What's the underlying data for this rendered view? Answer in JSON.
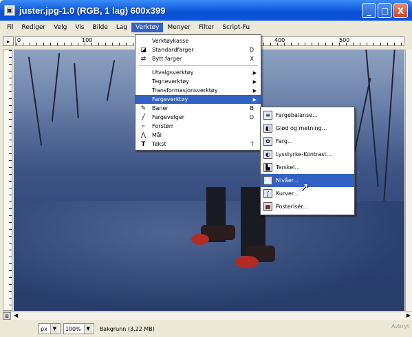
{
  "window": {
    "title": "juster.jpg-1.0 (RGB, 1 lag) 600x399",
    "controls": [
      "_",
      "□",
      "X"
    ]
  },
  "menubar": {
    "items": [
      "Fil",
      "Rediger",
      "Velg",
      "Vis",
      "Bilde",
      "Lag",
      "Verktøy",
      "Menyer",
      "Filter",
      "Script-Fu"
    ],
    "active": "Verktøy"
  },
  "ruler": {
    "labels": [
      "0",
      "100",
      "400",
      "500"
    ]
  },
  "tools_menu": {
    "items": [
      {
        "label": "Verktøykasse",
        "icon": "",
        "shortcut": "",
        "submenu": false
      },
      {
        "label": "Standardfarger",
        "icon": "default-colors-icon",
        "shortcut": "D",
        "submenu": false
      },
      {
        "label": "Bytt farger",
        "icon": "swap-colors-icon",
        "shortcut": "X",
        "submenu": false
      },
      {
        "separator": true
      },
      {
        "label": "Utvalgsverktøy",
        "icon": "",
        "shortcut": "",
        "submenu": true
      },
      {
        "label": "Tegneverktøy",
        "icon": "",
        "shortcut": "",
        "submenu": true
      },
      {
        "label": "Transformasjonsverktøy",
        "icon": "",
        "shortcut": "",
        "submenu": true
      },
      {
        "label": "Fargeverktøy",
        "icon": "",
        "shortcut": "",
        "submenu": true,
        "highlighted": true
      },
      {
        "label": "Baner",
        "icon": "paths-icon",
        "shortcut": "B",
        "submenu": false
      },
      {
        "label": "Fargevelger",
        "icon": "color-picker-icon",
        "shortcut": "O",
        "submenu": false
      },
      {
        "label": "Forstørr",
        "icon": "zoom-icon",
        "shortcut": "",
        "submenu": false
      },
      {
        "label": "Mål",
        "icon": "measure-icon",
        "shortcut": "",
        "submenu": false
      },
      {
        "label": "Tekst",
        "icon": "text-icon",
        "shortcut": "T",
        "submenu": false
      }
    ]
  },
  "color_submenu": {
    "items": [
      {
        "label": "Fargebalanse...",
        "icon": "color-balance-icon"
      },
      {
        "label": "Glød og metning...",
        "icon": "hue-saturation-icon"
      },
      {
        "label": "Farg...",
        "icon": "colorize-icon"
      },
      {
        "label": "Lysstyrke-Kontrast...",
        "icon": "brightness-contrast-icon"
      },
      {
        "label": "Terskel...",
        "icon": "threshold-icon"
      },
      {
        "label": "Nivåer...",
        "icon": "levels-icon",
        "highlighted": true
      },
      {
        "label": "Kurver...",
        "icon": "curves-icon"
      },
      {
        "label": "Posterisér...",
        "icon": "posterize-icon"
      }
    ]
  },
  "status": {
    "unit": "px",
    "zoom": "100%",
    "layer_info": "Bakgrunn (3,22 MB)",
    "cancel": "Avbryt"
  }
}
